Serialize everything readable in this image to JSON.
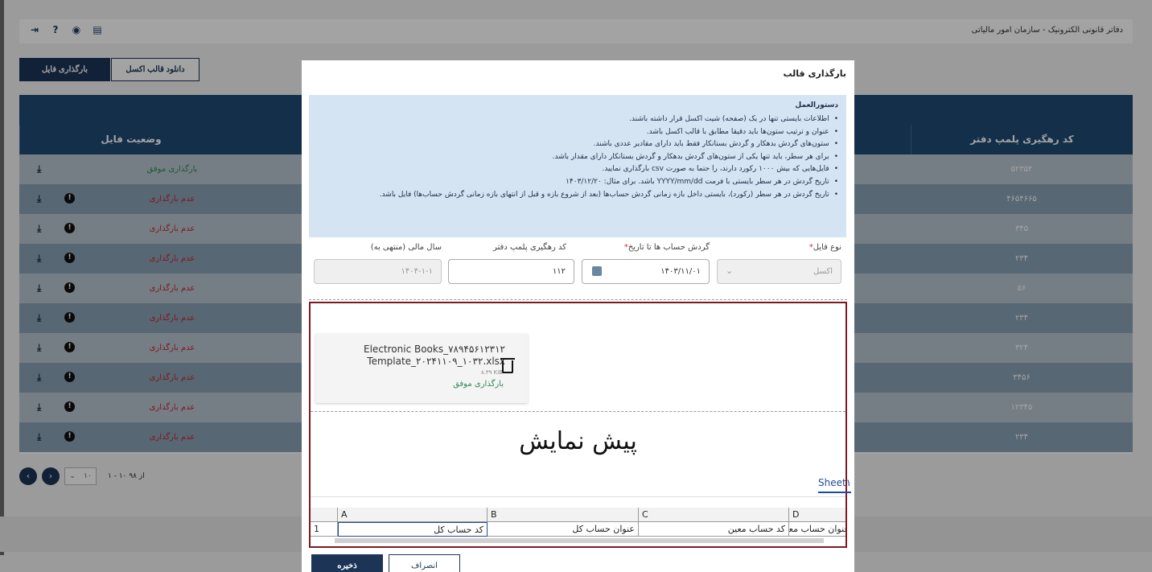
{
  "app": {
    "title": "دفاتر قانونی الکترونیک - سازمان امور مالیاتی",
    "icons": [
      "logout-icon",
      "help-icon",
      "fingerprint-icon",
      "list-icon"
    ]
  },
  "toolbar": {
    "upload_label": "بارگذاری فایل",
    "download_label": "دانلود قالب اکسل"
  },
  "grid": {
    "headers": {
      "status": "وضعیت فایل",
      "code": "کد رهگیری پلمپ دفتر"
    },
    "rows": [
      {
        "status": "بارگذاری موفق",
        "ok": true,
        "code": "۵۲۳۵۲"
      },
      {
        "status": "عدم بارگذاری",
        "ok": false,
        "code": "۴۶۵۴۶۶۵"
      },
      {
        "status": "عدم بارگذاری",
        "ok": false,
        "code": "۳۴۵"
      },
      {
        "status": "عدم بارگذاری",
        "ok": false,
        "code": "۲۳۴"
      },
      {
        "status": "عدم بارگذاری",
        "ok": false,
        "code": "۵۶"
      },
      {
        "status": "عدم بارگذاری",
        "ok": false,
        "code": "۲۳۴"
      },
      {
        "status": "عدم بارگذاری",
        "ok": false,
        "code": "۳۲۴"
      },
      {
        "status": "عدم بارگذاری",
        "ok": false,
        "code": "۳۴۵۶"
      },
      {
        "status": "عدم بارگذاری",
        "ok": false,
        "code": "۱۲۳۴۵"
      },
      {
        "status": "عدم بارگذاری",
        "ok": false,
        "code": "۲۳۴"
      }
    ]
  },
  "pager": {
    "page_size": "۱۰",
    "info": "۱ - ۱۰ از ۹۸"
  },
  "modal": {
    "title": "بارگذاری قالب",
    "instructions_title": "دستورالعمل",
    "instructions": [
      "اطلاعات بایستی تنها در یک (صفحه) شیت اکسل قرار داشته باشند.",
      "عنوان و ترتیب ستون‌ها باید دقیقا مطابق با قالب اکسل باشد.",
      "ستون‌های گردش بدهکار و گردش بستانکار فقط باید دارای مقادیر عددی باشند.",
      "برای هر سطر، باید تنها یکی از ستون‌های گردش بدهکار و گردش بستانکار دارای مقدار باشد.",
      "فایل‌هایی که بیش ۱۰۰۰ رکورد دارند، را حتما به صورت csv بارگذاری نمایید.",
      "تاریخ گردش در هر سطر بایستی با فرمت YYYY/mm/dd باشد. برای مثال: ۱۴۰۳/۱۲/۲۰",
      "تاریخ گردش در هر سطر (رکورد)، بایستی داخل بازه زمانی گردش حساب‌ها (بعد از شروع بازه و قبل از انتهای بازه زمانی گردش حساب‌ها) فایل باشد."
    ],
    "fields": {
      "file_type": {
        "label": "نوع فایل",
        "value": "اکسل"
      },
      "date_to": {
        "label": "گردش حساب ها تا تاریخ",
        "value": "۱۴۰۳/۱۱/۰۱"
      },
      "seal_code": {
        "label": "کد رهگیری پلمپ دفتر",
        "value": "۱۱۲"
      },
      "fiscal_year": {
        "label": "سال مالی (منتهی به)",
        "value": "۱۴۰۴-۱-۱"
      }
    },
    "file": {
      "name": "Electronic Books_۷۸۹۴۵۶۱۲۳۱۲ Template_۲۰۲۴۱۱۰۹_۱۰۳۲.xlsx",
      "size": "۸.۳۹ KiB",
      "status": "بارگذاری موفق"
    },
    "preview": {
      "title": "پیش نمایش",
      "sheet_tab": "Sheet۱",
      "columns": [
        "A",
        "B",
        "C",
        "D"
      ],
      "row_number": "1",
      "row": [
        "کد حساب کل",
        "عنوان حساب کل",
        "کد حساب معین",
        "عنوان حساب معین"
      ]
    },
    "save_label": "ذخیره",
    "cancel_label": "انصراف"
  },
  "colors": {
    "primary": "#1c3557",
    "header": "#1e4a73",
    "success": "#2e8b57",
    "error": "#c6282e",
    "upload_border": "#7b1a23"
  }
}
